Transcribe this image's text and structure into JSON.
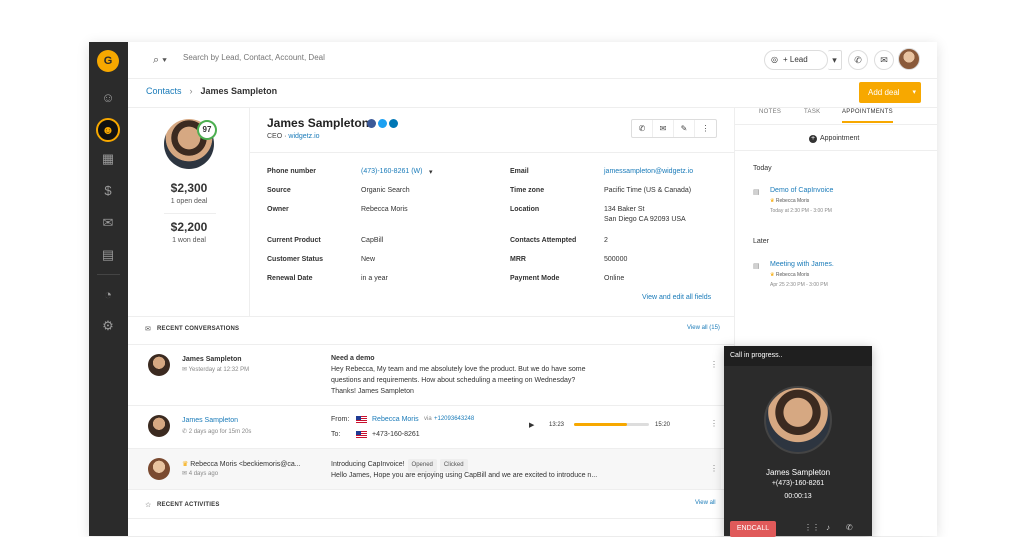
{
  "app": {
    "logo_glyph": "G"
  },
  "sidebar": {
    "icons": [
      "contacts-icon",
      "user-icon",
      "building-icon",
      "dollar-icon",
      "chat-icon",
      "calendar-icon",
      "reports-icon",
      "settings-icon"
    ]
  },
  "topbar": {
    "search_placeholder": "Search by Lead, Contact, Account, Deal",
    "lead_label": "+ Lead"
  },
  "breadcrumb": {
    "parent": "Contacts",
    "current": "James Sampleton"
  },
  "add_deal_label": "Add deal",
  "contact": {
    "name": "James Sampleton",
    "role": "CEO",
    "company": "widgetz.io",
    "score": "97",
    "open_deal_amount": "$2,300",
    "open_deal_label": "1 open deal",
    "won_deal_amount": "$2,200",
    "won_deal_label": "1 won deal"
  },
  "fields_left": [
    {
      "label": "Phone number",
      "value": "(473)-160-8261 (W)"
    },
    {
      "label": "Source",
      "value": "Organic Search"
    },
    {
      "label": "Owner",
      "value": "Rebecca Moris"
    },
    {
      "label": "Current Product",
      "value": "CapBill"
    },
    {
      "label": "Customer Status",
      "value": "New"
    },
    {
      "label": "Renewal Date",
      "value": "in a year"
    }
  ],
  "fields_right": [
    {
      "label": "Email",
      "value": "jamessampleton@widgetz.io"
    },
    {
      "label": "Time zone",
      "value": "Pacific Time (US & Canada)"
    },
    {
      "label": "Location",
      "value": "134 Baker St",
      "value2": "San Diego CA 92093 USA"
    },
    {
      "label": "Contacts Attempted",
      "value": "2"
    },
    {
      "label": "MRR",
      "value": "500000"
    },
    {
      "label": "Payment Mode",
      "value": "Online"
    }
  ],
  "view_edit_label": "View and edit all fields",
  "conversations": {
    "title": "RECENT CONVERSATIONS",
    "view_all": "View all (15)",
    "items": [
      {
        "name": "James Sampleton",
        "meta": "Yesterday at 12:32 PM",
        "subject": "Need a demo",
        "body1": "Hey Rebecca, My team and me absolutely love the product.  But we do have some",
        "body2": "questions and requirements. How about scheduling a meeting on Wednesday?",
        "body3": "Thanks! James Sampleton"
      },
      {
        "name": "James Sampleton",
        "meta": "2 days ago for 15m 20s",
        "from_label": "From:",
        "from_name": "Rebecca Moris",
        "from_via": "via",
        "from_number": "+12093643248",
        "to_label": "To:",
        "to_number": "+473-160-8261",
        "time_start": "13:23",
        "time_end": "15:20",
        "progress": 0.7
      },
      {
        "name": "Rebecca Moris <beckiemoris@ca...",
        "meta": "4 days ago",
        "subject": "Introducing CapInvoice!",
        "tag1": "Opened",
        "tag2": "Clicked",
        "body1": "Hello James, Hope you are enjoying using CapBill and we are excited to introduce n..."
      }
    ]
  },
  "activities": {
    "title": "RECENT ACTIVITIES",
    "view_all": "View all"
  },
  "right_panel": {
    "tabs": [
      "NOTES",
      "TASK",
      "APPOINTMENTS"
    ],
    "appointment_label": "Appointment",
    "today_label": "Today",
    "later_label": "Later",
    "today_event": {
      "title": "Demo of CapInvoice",
      "owner": "Rebecca Moris",
      "time": "Today at 2:30 PM - 3:00 PM"
    },
    "later_event": {
      "title": "Meeting with James.",
      "owner": "Rebecca Moris",
      "time": "Apr 25 2:30 PM - 3:00 PM"
    }
  },
  "call": {
    "status": "Call in progress..",
    "name": "James Sampleton",
    "number": "+(473)-160-8261",
    "duration": "00:00:13",
    "end_label": "ENDCALL"
  },
  "colors": {
    "accent": "#f7a800",
    "link": "#1a7bb9",
    "sidebar": "#2b2b2b",
    "end_call": "#e05a5a"
  }
}
